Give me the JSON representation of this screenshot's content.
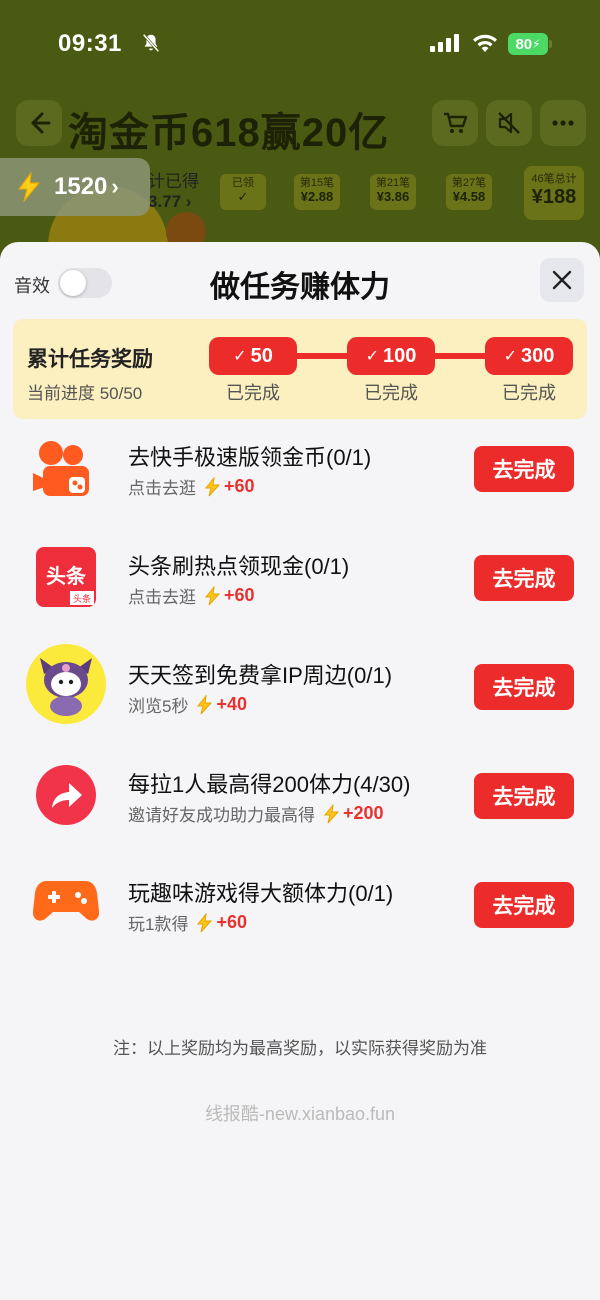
{
  "status_bar": {
    "time": "09:31",
    "battery": "80"
  },
  "background": {
    "title": "淘金币618赢20亿",
    "coin_balance": "1520",
    "progress_label_line1": "计已得",
    "progress_label_line2": "3.77 ›",
    "steps": [
      {
        "label": "已领",
        "amount": "✓"
      },
      {
        "label": "第15笔",
        "amount": "¥2.88"
      },
      {
        "label": "第21笔",
        "amount": "¥3.86"
      },
      {
        "label": "第27笔",
        "amount": "¥4.58"
      }
    ],
    "final_step": {
      "label": "46笔总计",
      "amount": "¥188"
    }
  },
  "sheet": {
    "sound_label": "音效",
    "title": "做任务赚体力",
    "reward_box": {
      "title": "累计任务奖励",
      "progress": "当前进度 50/50",
      "milestones": [
        {
          "value": "50",
          "status": "已完成"
        },
        {
          "value": "100",
          "status": "已完成"
        },
        {
          "value": "300",
          "status": "已完成"
        }
      ]
    },
    "tasks": [
      {
        "title": "去快手极速版领金币(0/1)",
        "subtitle": "点击去逛",
        "reward": "+60",
        "button": "去完成",
        "icon": "kuaishou-icon"
      },
      {
        "title": "头条刷热点领现金(0/1)",
        "subtitle": "点击去逛",
        "reward": "+60",
        "button": "去完成",
        "icon": "toutiao-icon"
      },
      {
        "title": "天天签到免费拿IP周边(0/1)",
        "subtitle": "浏览5秒",
        "reward": "+40",
        "button": "去完成",
        "icon": "kuromi-avatar"
      },
      {
        "title": "每拉1人最高得200体力(4/30)",
        "subtitle": "邀请好友成功助力最高得",
        "reward": "+200",
        "button": "去完成",
        "icon": "share-icon"
      },
      {
        "title": "玩趣味游戏得大额体力(0/1)",
        "subtitle": "玩1款得",
        "reward": "+60",
        "button": "去完成",
        "icon": "gamepad-icon"
      }
    ],
    "toutiao_badge_big": "头条",
    "toutiao_badge_small": "头条",
    "note": "注：以上奖励均为最高奖励，以实际获得奖励为准",
    "watermark": "线报酷-new.xianbao.fun"
  },
  "colors": {
    "accent_red": "#ec2b2b",
    "reward_bg": "#fcefc0",
    "sheet_bg": "#f5f5f7"
  }
}
